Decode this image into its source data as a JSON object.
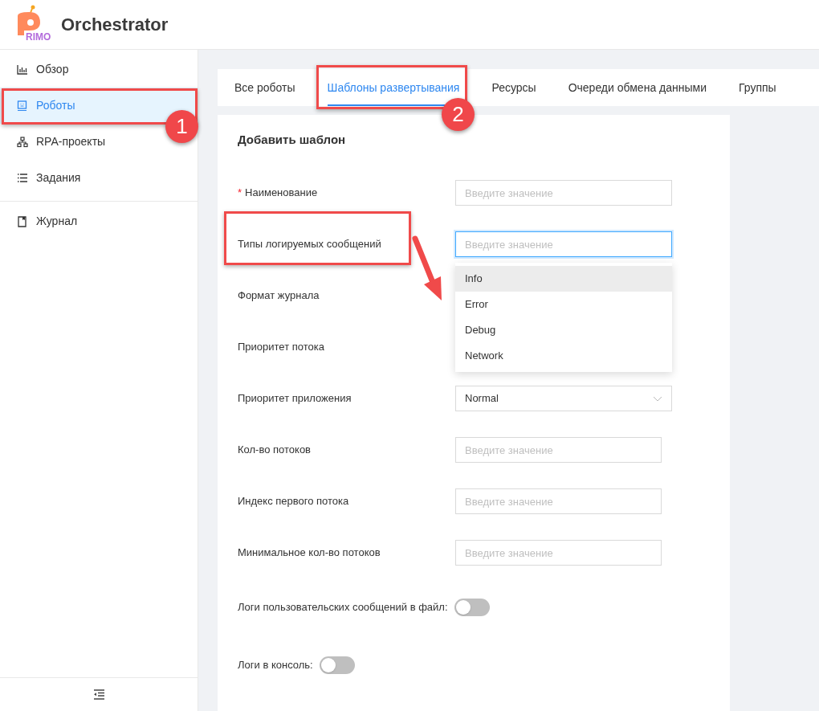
{
  "header": {
    "logo_text": "RIMO",
    "title": "Orchestrator"
  },
  "sidebar": {
    "groups": [
      [
        {
          "label": "Обзор",
          "selected": false
        },
        {
          "label": "Роботы",
          "selected": true
        },
        {
          "label": "RPA-проекты",
          "selected": false
        },
        {
          "label": "Задания",
          "selected": false
        }
      ],
      [
        {
          "label": "Журнал",
          "selected": false
        }
      ]
    ]
  },
  "tabs": [
    {
      "label": "Все роботы",
      "selected": false
    },
    {
      "label": "Шаблоны развертывания",
      "selected": true
    },
    {
      "label": "Ресурсы",
      "selected": false
    },
    {
      "label": "Очереди обмена данными",
      "selected": false
    },
    {
      "label": "Группы",
      "selected": false
    }
  ],
  "form": {
    "title": "Добавить шаблон",
    "fields": [
      {
        "label": "Наименование",
        "required_mark": "*",
        "kind": "text",
        "placeholder": "Введите значение",
        "focused": false
      },
      {
        "label": "Типы логируемых сообщений",
        "kind": "text",
        "placeholder": "Введите значение",
        "focused": true
      },
      {
        "label": "Формат журнала",
        "kind": "covered"
      },
      {
        "label": "Приоритет потока",
        "kind": "covered"
      },
      {
        "label": "Приоритет приложения",
        "kind": "select",
        "value": "Normal"
      },
      {
        "label": "Кол-во потоков",
        "kind": "number",
        "placeholder": "Введите значение",
        "focused": false
      },
      {
        "label": "Индекс первого потока",
        "kind": "number",
        "placeholder": "Введите значение",
        "focused": false
      },
      {
        "label": "Минимальное кол-во потоков",
        "kind": "number",
        "placeholder": "Введите значение",
        "focused": false
      },
      {
        "label": "Логи пользовательских сообщений в файл:",
        "kind": "toggle",
        "on": false
      },
      {
        "label": "Логи в консоль:",
        "kind": "toggle",
        "on": false
      }
    ]
  },
  "dropdown": {
    "options": [
      {
        "label": "Info",
        "selected": true
      },
      {
        "label": "Error",
        "selected": false
      },
      {
        "label": "Debug",
        "selected": false
      },
      {
        "label": "Network",
        "selected": false
      }
    ]
  },
  "annotations": {
    "badges": [
      "1",
      "2"
    ]
  }
}
